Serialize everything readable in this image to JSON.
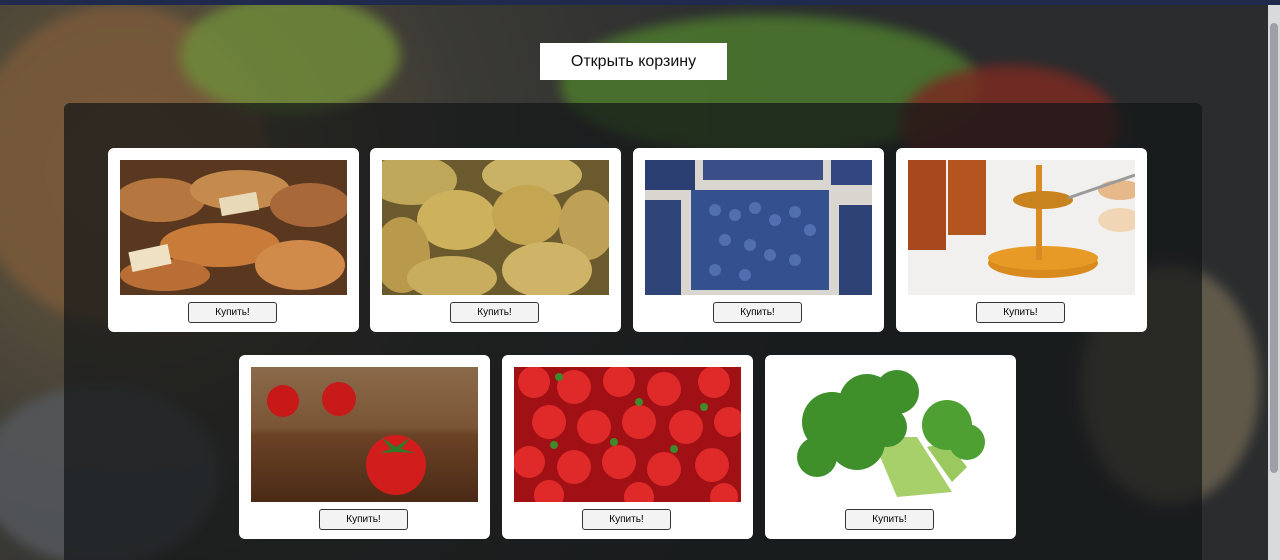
{
  "header": {
    "open_cart_label": "Открыть корзину"
  },
  "products": [
    {
      "image_icon": "bread-image",
      "buy_label": "Купить!"
    },
    {
      "image_icon": "potatoes-image",
      "buy_label": "Купить!"
    },
    {
      "image_icon": "blueberries-image",
      "buy_label": "Купить!"
    },
    {
      "image_icon": "honey-image",
      "buy_label": "Купить!"
    },
    {
      "image_icon": "tomatoes-image",
      "buy_label": "Купить!"
    },
    {
      "image_icon": "strawberries-image",
      "buy_label": "Купить!"
    },
    {
      "image_icon": "broccoli-image",
      "buy_label": "Купить!"
    }
  ],
  "colors": {
    "panel": "#15171a",
    "card": "#ffffff",
    "topbar": "#1f2a4d"
  }
}
